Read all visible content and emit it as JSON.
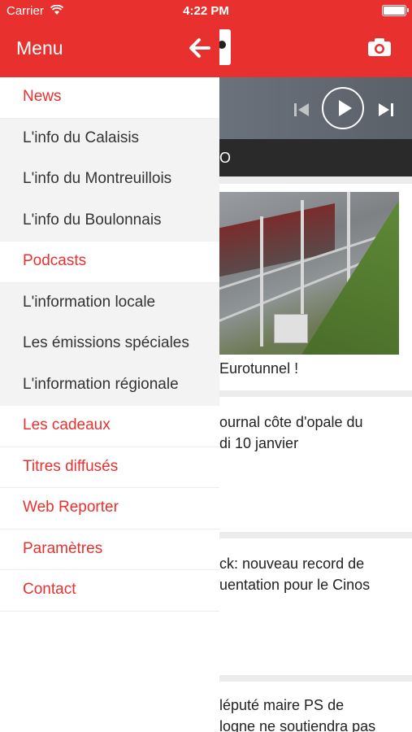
{
  "status_bar": {
    "carrier": "Carrier",
    "time": "4:22 PM"
  },
  "drawer": {
    "title": "Menu",
    "items": [
      {
        "label": "News",
        "kind": "section"
      },
      {
        "label": "L'info du Calaisis",
        "kind": "sub"
      },
      {
        "label": "L'info du Montreuillois",
        "kind": "sub"
      },
      {
        "label": "L'info du Boulonnais",
        "kind": "sub"
      },
      {
        "label": "Podcasts",
        "kind": "section"
      },
      {
        "label": "L'information locale",
        "kind": "sub"
      },
      {
        "label": "Les émissions spéciales",
        "kind": "sub"
      },
      {
        "label": "L'information régionale",
        "kind": "sub"
      },
      {
        "label": "Les cadeaux",
        "kind": "section"
      },
      {
        "label": "Titres diffusés",
        "kind": "section"
      },
      {
        "label": "Web Reporter",
        "kind": "section"
      },
      {
        "label": "Paramètres",
        "kind": "section"
      },
      {
        "label": "Contact",
        "kind": "section"
      }
    ]
  },
  "background": {
    "ticker": "O",
    "articles": [
      {
        "lines": [
          "Eurotunnel !"
        ]
      },
      {
        "lines": [
          "ournal côte d'opale du",
          "di 10 janvier"
        ]
      },
      {
        "lines": [
          "ck: nouveau record de",
          "uentation pour le Cinos"
        ]
      },
      {
        "lines": [
          "léputé maire PS de",
          "logne ne soutiendra pas"
        ]
      }
    ]
  },
  "colors": {
    "brand_red": "#e8312f",
    "sub_bg": "#f3f3f3"
  },
  "icons": [
    "wifi-icon",
    "battery-icon",
    "back-arrow-icon",
    "camera-icon",
    "previous-icon",
    "play-icon",
    "next-icon"
  ]
}
